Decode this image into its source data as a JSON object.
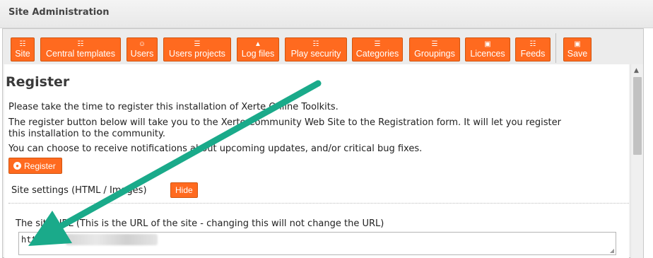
{
  "window": {
    "title": "Site Administration"
  },
  "toolbar": {
    "buttons": [
      {
        "label": "Site",
        "icon": "sitemap-icon"
      },
      {
        "label": "Central templates",
        "icon": "templates-icon"
      },
      {
        "label": "Users",
        "icon": "users-icon"
      },
      {
        "label": "Users projects",
        "icon": "document-icon"
      },
      {
        "label": "Log files",
        "icon": "warning-icon"
      },
      {
        "label": "Play security",
        "icon": "key-icon"
      },
      {
        "label": "Categories",
        "icon": "list-icon"
      },
      {
        "label": "Groupings",
        "icon": "list-icon"
      },
      {
        "label": "Licences",
        "icon": "cc-icon"
      },
      {
        "label": "Feeds",
        "icon": "rss-icon"
      },
      {
        "label": "Save",
        "icon": "save-icon"
      }
    ]
  },
  "main": {
    "heading": "Register",
    "paragraphs": [
      "Please take the time to register this installation of Xerte Online Toolkits.",
      "The register button below will take you to the Xerte Community Web Site to the Registration form. It will let you register",
      "this installation to the community.",
      "You can choose to receive notifications about upcoming updates, and/or critical bug fixes."
    ],
    "register_button": "Register",
    "settings_label": "Site settings (HTML / Images)",
    "hide_button": "Hide",
    "site_url_label": "The site URL (This is the URL of the site - changing this will not change the URL)",
    "site_url_value": "https://"
  },
  "colors": {
    "accent": "#ff6a1f",
    "annotation_arrow": "#1aaa8a"
  }
}
